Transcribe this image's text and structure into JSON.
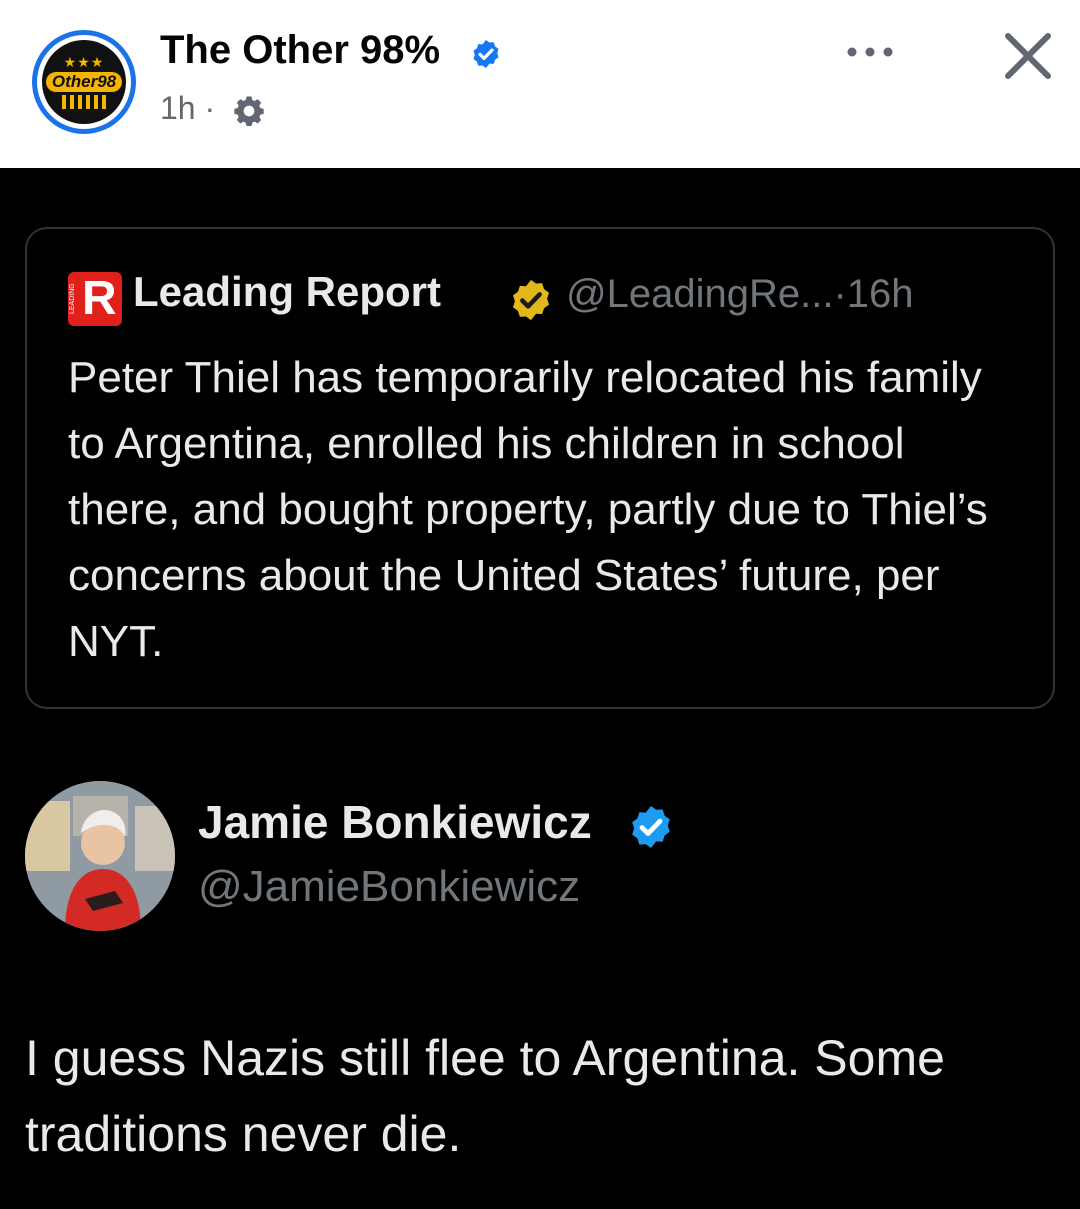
{
  "header": {
    "page_name": "The Other 98%",
    "time": "1h",
    "separator": "·",
    "avatar_logo_text": "Other98"
  },
  "quoted_tweet": {
    "author_name": "Leading Report",
    "handle": "@LeadingRe...",
    "time": "·16h",
    "logo_letter": "R",
    "logo_small_text": "LEADING",
    "text": "Peter Thiel has temporarily relocated his family to Argentina, enrolled his children in school there, and bought property, partly due to Thiel’s concerns about the United States’ future, per NYT."
  },
  "main_tweet": {
    "author_name": "Jamie Bonkiewicz",
    "handle": "@JamieBonkiewicz",
    "text": "I guess Nazis still flee to Argentina. Some traditions never die."
  },
  "colors": {
    "fb_verified": "#1877f2",
    "x_verified_blue": "#1d9bf0",
    "x_verified_gold": "#e2b719",
    "leading_report_red": "#e0201b"
  }
}
